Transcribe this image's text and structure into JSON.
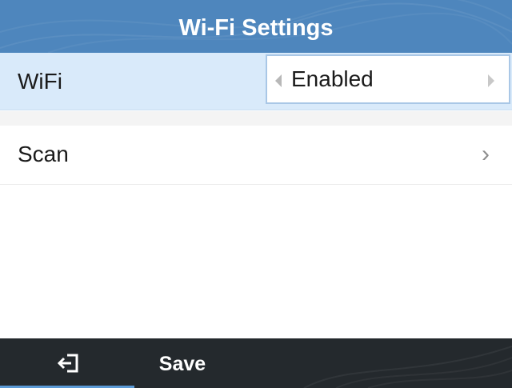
{
  "header": {
    "title": "Wi-Fi Settings"
  },
  "settings": {
    "wifi": {
      "label": "WiFi",
      "value": "Enabled"
    },
    "scan": {
      "label": "Scan",
      "chevron": "›"
    }
  },
  "softkeys": {
    "back_icon": "back-exit-icon",
    "save_label": "Save"
  },
  "colors": {
    "title_bar": "#4e86bd",
    "selected_row": "#d9eafa",
    "bottom_bar": "#24292d",
    "accent": "#5b9ad6"
  }
}
